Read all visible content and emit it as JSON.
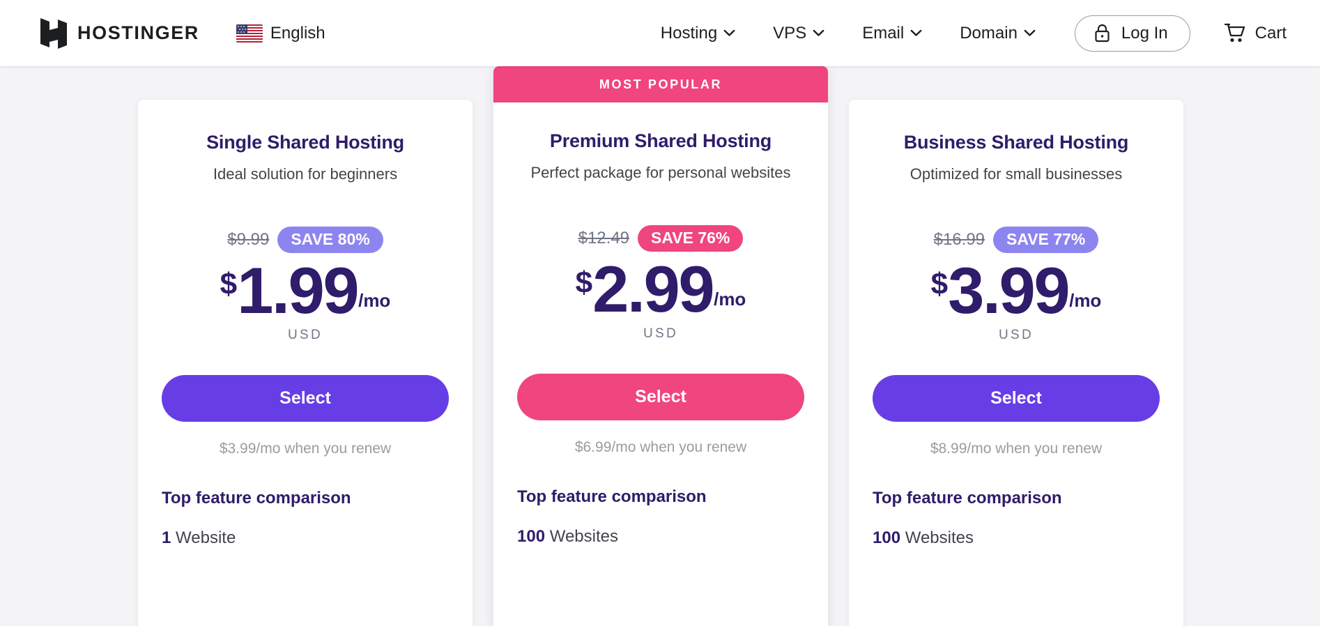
{
  "header": {
    "logo_text": "HOSTINGER",
    "logo_icon": "hostinger-h-logo",
    "language": {
      "label": "English",
      "flag_icon": "us-flag-icon"
    },
    "nav": [
      {
        "label": "Hosting",
        "icon": "chevron-down-icon"
      },
      {
        "label": "VPS",
        "icon": "chevron-down-icon"
      },
      {
        "label": "Email",
        "icon": "chevron-down-icon"
      },
      {
        "label": "Domain",
        "icon": "chevron-down-icon"
      }
    ],
    "login": {
      "label": "Log In",
      "icon": "lock-icon"
    },
    "cart": {
      "label": "Cart",
      "icon": "shopping-cart-icon"
    }
  },
  "plans": [
    {
      "badge": "",
      "title": "Single Shared Hosting",
      "subtitle": "Ideal solution for beginners",
      "old_price": "$9.99",
      "save_label": "SAVE 80%",
      "save_color": "#8c85f0",
      "currency_symbol": "$",
      "price": "1.99",
      "period": "/mo",
      "currency_code": "USD",
      "cta_label": "Select",
      "cta_color": "#673de6",
      "renew_note": "$3.99/mo when you renew",
      "features_title": "Top feature comparison",
      "feature_value": "1",
      "feature_label": "Website"
    },
    {
      "badge": "MOST POPULAR",
      "title": "Premium Shared Hosting",
      "subtitle": "Perfect package for personal websites",
      "old_price": "$12.49",
      "save_label": "SAVE 76%",
      "save_color": "#f0457f",
      "currency_symbol": "$",
      "price": "2.99",
      "period": "/mo",
      "currency_code": "USD",
      "cta_label": "Select",
      "cta_color": "#f0457f",
      "renew_note": "$6.99/mo when you renew",
      "features_title": "Top feature comparison",
      "feature_value": "100",
      "feature_label": "Websites"
    },
    {
      "badge": "",
      "title": "Business Shared Hosting",
      "subtitle": "Optimized for small businesses",
      "old_price": "$16.99",
      "save_label": "SAVE 77%",
      "save_color": "#8c85f0",
      "currency_symbol": "$",
      "price": "3.99",
      "period": "/mo",
      "currency_code": "USD",
      "cta_label": "Select",
      "cta_color": "#673de6",
      "renew_note": "$8.99/mo when you renew",
      "features_title": "Top feature comparison",
      "feature_value": "100",
      "feature_label": "Websites"
    }
  ]
}
